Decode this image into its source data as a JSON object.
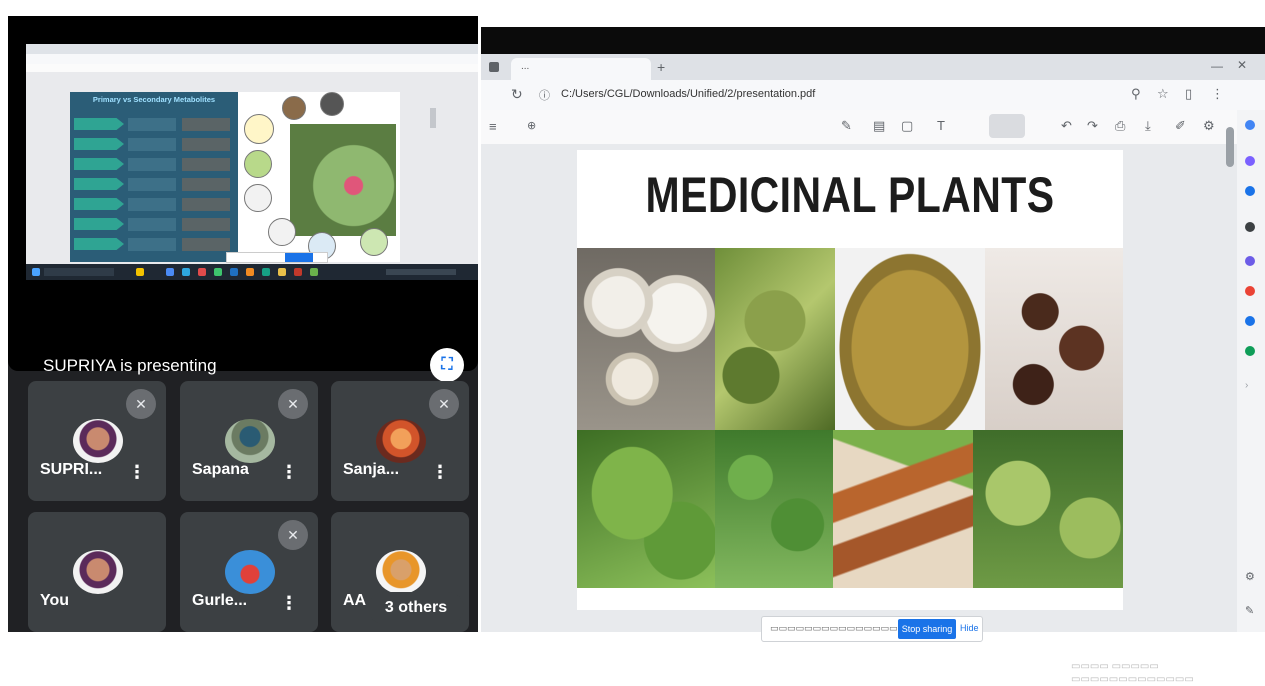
{
  "meet": {
    "presenting_text": "SUPRIYA is presenting",
    "fullscreen_icon": "fullscreen-icon",
    "others_label": "3 others",
    "participants": [
      {
        "name": "SUPRI...",
        "muted": true
      },
      {
        "name": "Sapana",
        "muted": true
      },
      {
        "name": "Sanja...",
        "muted": true
      },
      {
        "name": "You",
        "muted": false
      },
      {
        "name": "Gurle...",
        "muted": true
      },
      {
        "name": "AA",
        "muted": false
      }
    ]
  },
  "mini_slide": {
    "title": "Primary vs Secondary Metabolites"
  },
  "browser": {
    "tab_title": "...",
    "url": "C:/Users/CGL/Downloads/Unified/2/presentation.pdf",
    "share_bar_button": "Stop sharing",
    "share_bar_hide": "Hide"
  },
  "slide": {
    "title": "MEDICINAL PLANTS"
  },
  "colors": {
    "meet_bg": "#202124",
    "tile_bg": "#3c4043",
    "accent_blue": "#1a73e8"
  }
}
